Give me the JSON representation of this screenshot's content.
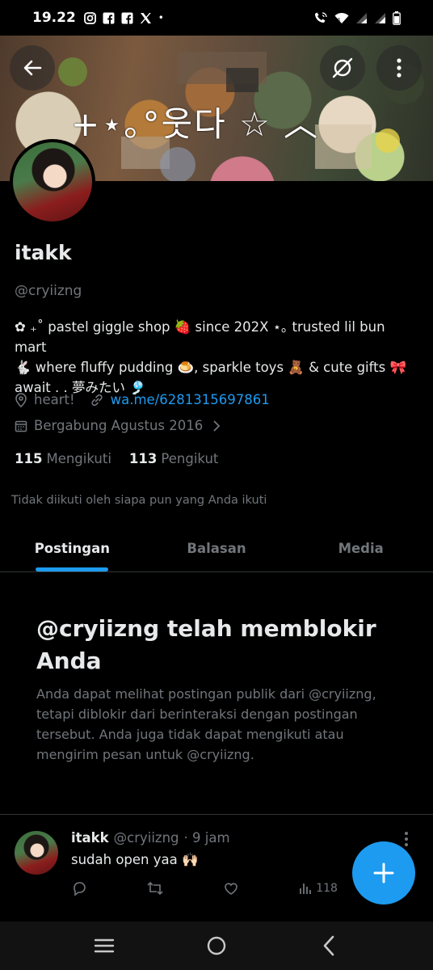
{
  "status_bar": {
    "time": "19.22",
    "dot": "•",
    "left_icons": [
      "instagram-icon",
      "facebook-icon",
      "facebook-icon",
      "x-icon"
    ],
    "right_icons": [
      "wifi-call-icon",
      "wifi-icon",
      "signal-icon",
      "signal-icon",
      "battery-icon"
    ]
  },
  "banner": {
    "text": "+⋆｡°웃다 ☆ ︿"
  },
  "profile": {
    "name": "itakk",
    "handle": "@cryiizng",
    "bio_lines": [
      "✿ ₊˚ pastel giggle shop 🍓 since 202X ⋆｡ trusted lil bun mart",
      "🐇 where fluffy pudding 🍮, sparkle toys 🧸 & cute gifts 🎀",
      "await . . 夢みたい 🎐"
    ],
    "location": "heart!",
    "website": "wa.me/6281315697861",
    "joined": "Bergabung Agustus 2016",
    "following_count": "115",
    "following_label": "Mengikuti",
    "followers_count": "113",
    "followers_label": "Pengikut",
    "not_followed_note": "Tidak diikuti oleh siapa pun yang Anda ikuti"
  },
  "tabs": [
    {
      "label": "Postingan",
      "active": true
    },
    {
      "label": "Balasan",
      "active": false
    },
    {
      "label": "Media",
      "active": false
    }
  ],
  "blocked": {
    "title": "@cryiizng telah memblokir Anda",
    "body": "Anda dapat melihat postingan publik dari @cryiizng, tetapi diblokir dari berinteraksi dengan postingan tersebut. Anda juga tidak dapat mengikuti atau mengirim pesan untuk @cryiizng."
  },
  "post": {
    "name": "itakk",
    "handle": "@cryiizng",
    "time": "· 9 jam",
    "text": "sudah open yaa 🙌🏻",
    "views": "118"
  },
  "colors": {
    "accent": "#1d9bf0",
    "background": "#000000",
    "muted": "#71767b",
    "text": "#e7e9ea"
  }
}
